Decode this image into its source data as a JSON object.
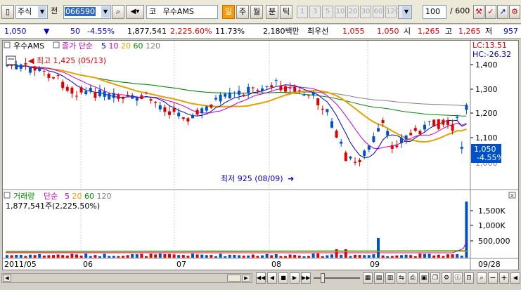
{
  "toolbar": {
    "market": "주식",
    "label_jeon": "전",
    "code": "066590",
    "prefix": "코",
    "name": "우수AMS",
    "btn_il": "일",
    "btn_ju": "주",
    "btn_wol": "월",
    "btn_bun": "분",
    "btn_tik": "틱",
    "periods": [
      "1",
      "3",
      "5",
      "10",
      "20",
      "30",
      "60",
      "120"
    ],
    "count": "100",
    "total": "/ 600"
  },
  "quote": {
    "price": "1,050",
    "arrow": "▼",
    "change": "50",
    "pct": "-4.55%",
    "volume": "1,877,541",
    "vol_pct": "2,225.60%",
    "turnover": "11.73%",
    "amount": "2,180백만",
    "pref_label": "최우선",
    "bid": "1,055",
    "ask": "1,050",
    "open_label": "시",
    "open": "1,265",
    "high_label": "고",
    "high": "1,265",
    "low_label": "저",
    "low": "957"
  },
  "price_panel": {
    "name_tag": "우수AMS",
    "legend_title": "종가 단순",
    "ma": [
      {
        "label": "5",
        "color": "#0000c8"
      },
      {
        "label": "10",
        "color": "#cc00cc"
      },
      {
        "label": "20",
        "color": "#e8a000"
      },
      {
        "label": "60",
        "color": "#009000"
      },
      {
        "label": "120",
        "color": "#808080"
      }
    ],
    "lc": "LC:13.51",
    "hc": "HC:-26.32",
    "high_annotation": "최고 1,425 (05/13)",
    "low_annotation": "최저 925 (08/09)",
    "axis_ticks": [
      "1,400",
      "1,300",
      "1,200",
      "1,100"
    ],
    "current_price": "1,050",
    "current_pct": "-4.55%",
    "hidden_tick": "1,000"
  },
  "volume_panel": {
    "title": "거래량",
    "legend_title": "단순",
    "ma": [
      {
        "label": "5",
        "color": "#cc00cc"
      },
      {
        "label": "20",
        "color": "#e8a000"
      },
      {
        "label": "60",
        "color": "#009000"
      },
      {
        "label": "120",
        "color": "#808080"
      }
    ],
    "value_text": "1,877,541주(2,225.50%)",
    "axis_ticks": [
      "1,500K",
      "1,000K",
      "500,000"
    ]
  },
  "x_axis": {
    "labels": [
      "2011/05",
      "06",
      "07",
      "08",
      "09"
    ],
    "right_date": "09/28"
  },
  "bottom_controls": {
    "zoom_minus": "−",
    "zoom_plus": "+"
  }
}
